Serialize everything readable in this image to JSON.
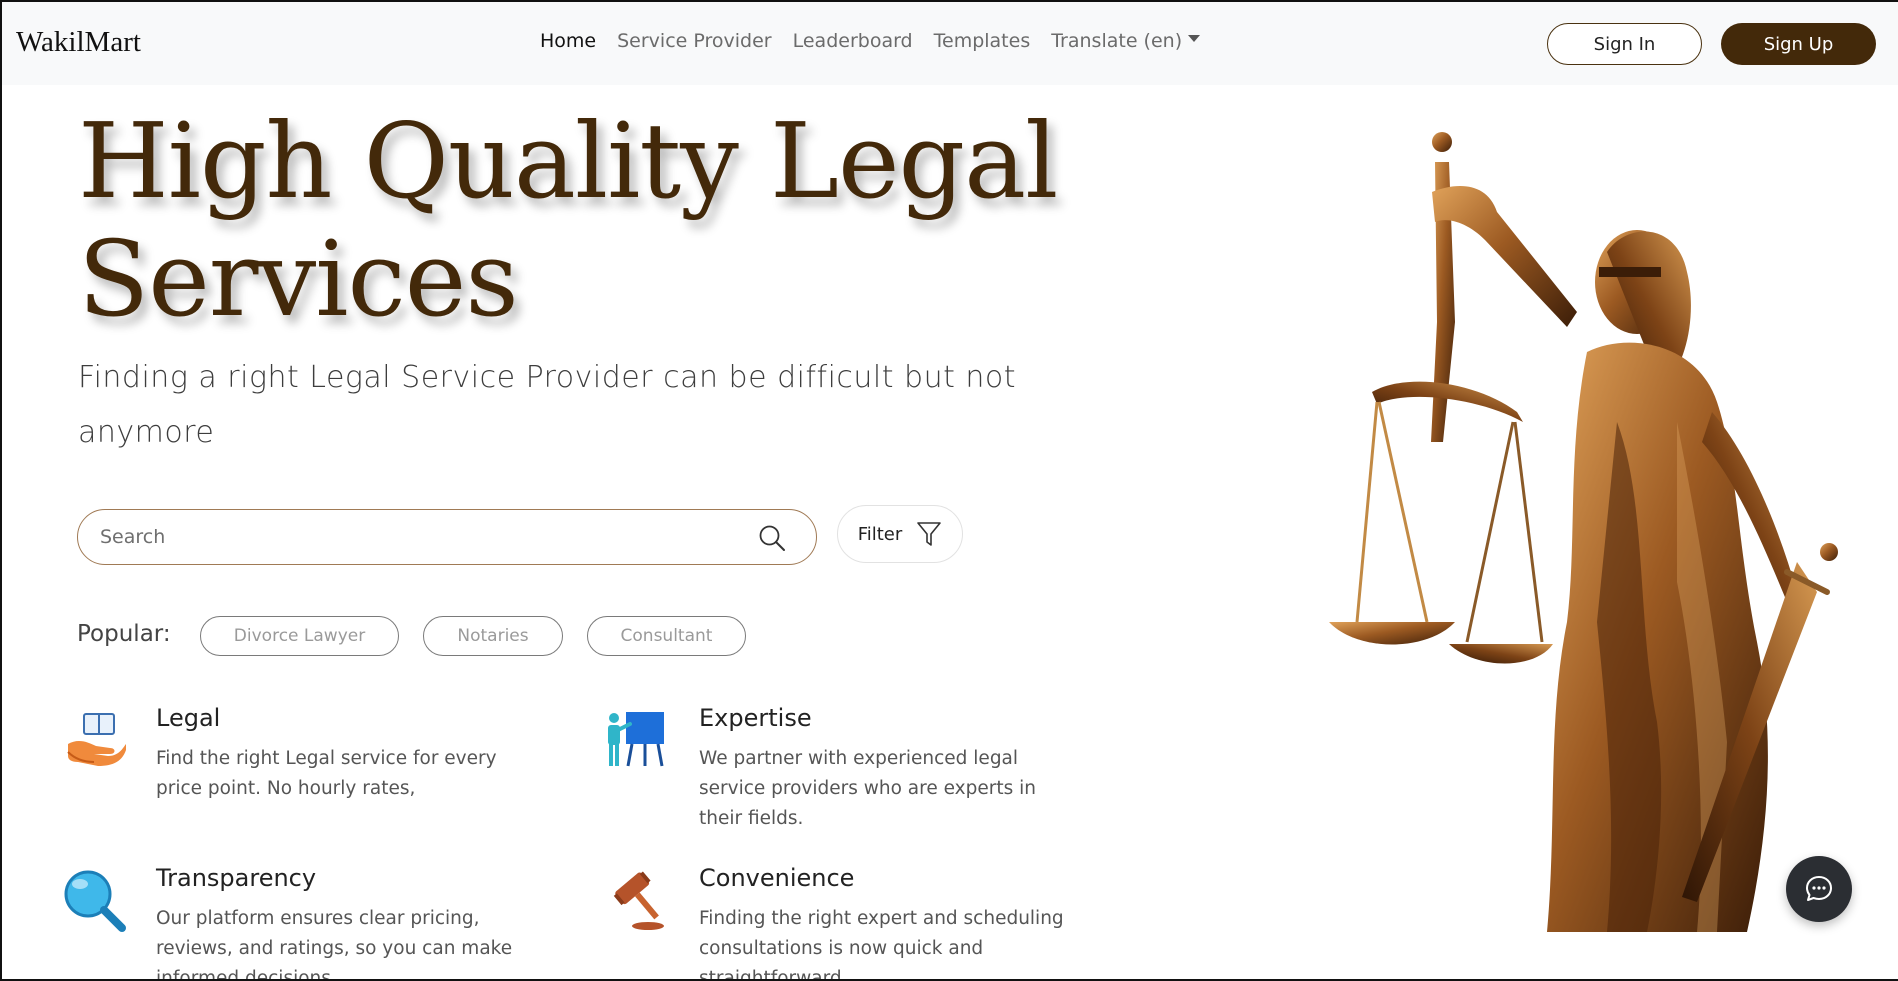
{
  "brand": "WakilMart",
  "nav": {
    "links": [
      "Home",
      "Service Provider",
      "Leaderboard",
      "Templates",
      "Translate (en)"
    ]
  },
  "auth": {
    "sign_in": "Sign In",
    "sign_up": "Sign Up"
  },
  "hero": {
    "title": "High Quality Legal Services",
    "subtitle": "Finding a right Legal Service Provider can be difficult but not anymore"
  },
  "search": {
    "placeholder": "Search",
    "filter_label": "Filter"
  },
  "popular": {
    "label": "Popular:",
    "tags": [
      "Divorce Lawyer",
      "Notaries",
      "Consultant"
    ]
  },
  "features": [
    {
      "title": "Legal",
      "desc": "Find the right Legal service for every price point. No hourly rates,",
      "icon": "open-book-hand-icon"
    },
    {
      "title": "Expertise",
      "desc": "We partner with experienced legal service providers who are experts in their fields.",
      "icon": "presenter-board-icon"
    },
    {
      "title": "Transparency",
      "desc": "Our platform ensures clear pricing, reviews, and ratings, so you can make informed decisions.",
      "icon": "magnifier-icon"
    },
    {
      "title": "Convenience",
      "desc": "Finding the right expert and scheduling consultations is now quick and straightforward.",
      "icon": "gavel-icon"
    }
  ],
  "colors": {
    "brand_brown": "#43290a",
    "nav_bg": "#f8f9fa",
    "chat_bg": "#2b2e33"
  }
}
